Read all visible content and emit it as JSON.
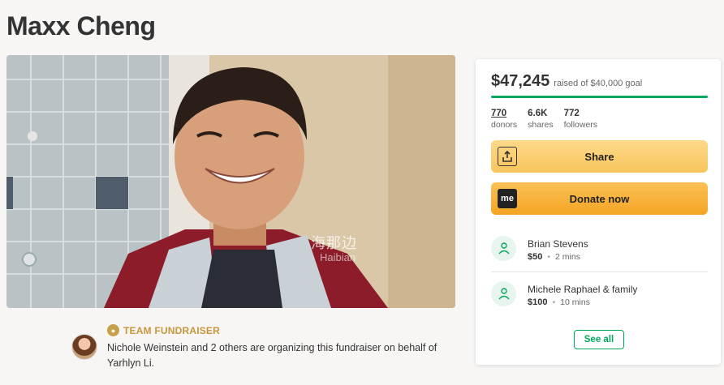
{
  "page": {
    "title": "Maxx Cheng"
  },
  "photo": {
    "alt": "photo-of-maxx-cheng",
    "watermark_main": "海那边",
    "watermark_sub": "Haibian"
  },
  "organizer": {
    "team_label": "TEAM FUNDRAISER",
    "text": "Nichole Weinstein and 2 others are organizing this fundraiser on behalf of Yarhlyn Li."
  },
  "card": {
    "raised_amount": "$47,245",
    "raised_goal": "raised of $40,000 goal",
    "progress_fraction": 1.0,
    "stats": [
      {
        "value": "770",
        "label": "donors"
      },
      {
        "value": "6.6K",
        "label": "shares"
      },
      {
        "value": "772",
        "label": "followers"
      }
    ],
    "share_label": "Share",
    "donate_label": "Donate now",
    "donate_icon_text": "me",
    "donors": [
      {
        "name": "Brian Stevens",
        "amount": "$50",
        "time": "2 mins"
      },
      {
        "name": "Michele Raphael & family",
        "amount": "$100",
        "time": "10 mins"
      }
    ],
    "see_all_label": "See all"
  },
  "colors": {
    "accent_green": "#02a95c",
    "share_yellow": "#f9c55d",
    "donate_orange": "#f4a523",
    "team_gold": "#c8963a"
  }
}
